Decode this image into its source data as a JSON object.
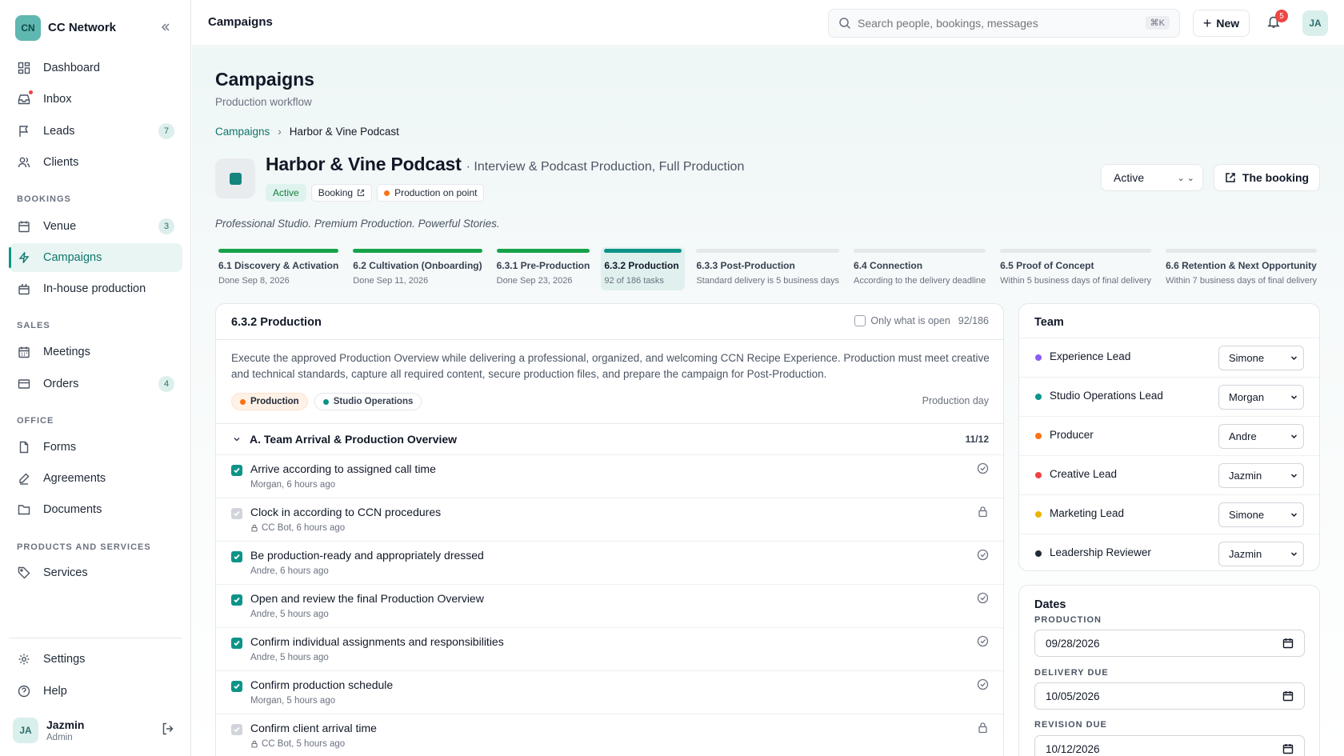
{
  "sidebar": {
    "brand_initials": "CN",
    "brand_name": "CC Network",
    "items": [
      {
        "label": "Dashboard",
        "icon": "dashboard-icon"
      },
      {
        "label": "Inbox",
        "icon": "inbox-icon"
      },
      {
        "label": "Leads",
        "icon": "flag-icon",
        "count": "7"
      },
      {
        "label": "Clients",
        "icon": "users-icon"
      }
    ],
    "sections": {
      "bookings": "BOOKINGS",
      "sales": "SALES",
      "office": "OFFICE",
      "products": "PRODUCTS AND SERVICES"
    },
    "bookings_items": [
      {
        "label": "Venue",
        "icon": "venue-icon",
        "count": "3"
      },
      {
        "label": "Campaigns",
        "icon": "bolt-icon"
      },
      {
        "label": "In-house production",
        "icon": "production-icon"
      }
    ],
    "sales_items": [
      {
        "label": "Meetings",
        "icon": "calendar-icon"
      },
      {
        "label": "Orders",
        "icon": "card-icon",
        "count": "4"
      }
    ],
    "office_items": [
      {
        "label": "Forms",
        "icon": "form-icon"
      },
      {
        "label": "Agreements",
        "icon": "pen-icon"
      },
      {
        "label": "Documents",
        "icon": "folder-icon"
      }
    ],
    "products_items": [
      {
        "label": "Services",
        "icon": "tag-icon"
      }
    ],
    "footer_items": [
      {
        "label": "Settings",
        "icon": "gear-icon"
      },
      {
        "label": "Help",
        "icon": "help-icon"
      }
    ],
    "user": {
      "initials": "JA",
      "name": "Jazmin",
      "role": "Admin"
    }
  },
  "topbar": {
    "title": "Campaigns",
    "search_placeholder": "Search people, bookings, messages",
    "search_shortcut": "⌘K",
    "new_label": "New",
    "notifications_count": "5",
    "avatar_initials": "JA"
  },
  "page": {
    "title": "Campaigns",
    "subtitle": "Production workflow",
    "breadcrumb_root": "Campaigns",
    "breadcrumb_current": "Harbor & Vine Podcast",
    "campaign_name": "Harbor & Vine Podcast",
    "campaign_desc": "· Interview & Podcast Production, Full Production",
    "chip_status": "Active",
    "chip_booking": "Booking",
    "chip_production": "Production on point",
    "status_select": "Active",
    "booking_button": "The booking",
    "tagline": "Professional Studio. Premium Production. Powerful Stories."
  },
  "steps": [
    {
      "name": "6.1 Discovery & Activation",
      "sub": "Done Sep 8, 2026",
      "state": "done"
    },
    {
      "name": "6.2 Cultivation (Onboarding)",
      "sub": "Done Sep 11, 2026",
      "state": "done"
    },
    {
      "name": "6.3.1 Pre-Production",
      "sub": "Done Sep 23, 2026",
      "state": "done"
    },
    {
      "name": "6.3.2 Production",
      "sub": "92 of 186 tasks",
      "state": "current"
    },
    {
      "name": "6.3.3 Post-Production",
      "sub": "Standard delivery is 5 business days",
      "state": "todo"
    },
    {
      "name": "6.4 Connection",
      "sub": "According to the delivery deadline",
      "state": "todo"
    },
    {
      "name": "6.5 Proof of Concept",
      "sub": "Within 5 business days of final delivery",
      "state": "todo"
    },
    {
      "name": "6.6 Retention & Next Opportunity",
      "sub": "Within 7 business days of final delivery",
      "state": "todo"
    }
  ],
  "task_panel": {
    "title": "6.3.2 Production",
    "filter_label": "Only what is open",
    "progress": "92/186",
    "description": "Execute the approved Production Overview while delivering a professional, organized, and welcoming CCN Recipe Experience. Production must meet creative and technical standards, capture all required content, secure production files, and prepare the campaign for Post-Production.",
    "tag_1": "Production",
    "tag_2": "Studio Operations",
    "production_day": "Production day",
    "group_name": "A. Team Arrival & Production Overview",
    "group_count": "11/12",
    "tasks": [
      {
        "name": "Arrive according to assigned call time",
        "meta": "Morgan, 6 hours ago",
        "locked": false
      },
      {
        "name": "Clock in according to CCN procedures",
        "meta": "CC Bot, 6 hours ago",
        "locked": true
      },
      {
        "name": "Be production-ready and appropriately dressed",
        "meta": "Andre, 6 hours ago",
        "locked": false
      },
      {
        "name": "Open and review the final Production Overview",
        "meta": "Andre, 5 hours ago",
        "locked": false
      },
      {
        "name": "Confirm individual assignments and responsibilities",
        "meta": "Andre, 5 hours ago",
        "locked": false
      },
      {
        "name": "Confirm production schedule",
        "meta": "Morgan, 5 hours ago",
        "locked": false
      },
      {
        "name": "Confirm client arrival time",
        "meta": "CC Bot, 5 hours ago",
        "locked": true
      }
    ]
  },
  "team": {
    "title": "Team",
    "rows": [
      {
        "role": "Experience Lead",
        "person": "Simone",
        "color": "#8b5cf6"
      },
      {
        "role": "Studio Operations Lead",
        "person": "Morgan",
        "color": "#0d9488"
      },
      {
        "role": "Producer",
        "person": "Andre",
        "color": "#f97316"
      },
      {
        "role": "Creative Lead",
        "person": "Jazmin",
        "color": "#ef4444"
      },
      {
        "role": "Marketing Lead",
        "person": "Simone",
        "color": "#eab308"
      },
      {
        "role": "Leadership Reviewer",
        "person": "Jazmin",
        "color": "#1f2937"
      }
    ]
  },
  "dates": {
    "title": "Dates",
    "production_label": "PRODUCTION",
    "production_value": "09/28/2026",
    "delivery_label": "DELIVERY DUE",
    "delivery_value": "10/05/2026",
    "revision_label": "REVISION DUE",
    "revision_value": "10/12/2026"
  },
  "colors": {
    "accent": "#0d9488",
    "done": "#16a34a",
    "badge": "#ef4444"
  }
}
